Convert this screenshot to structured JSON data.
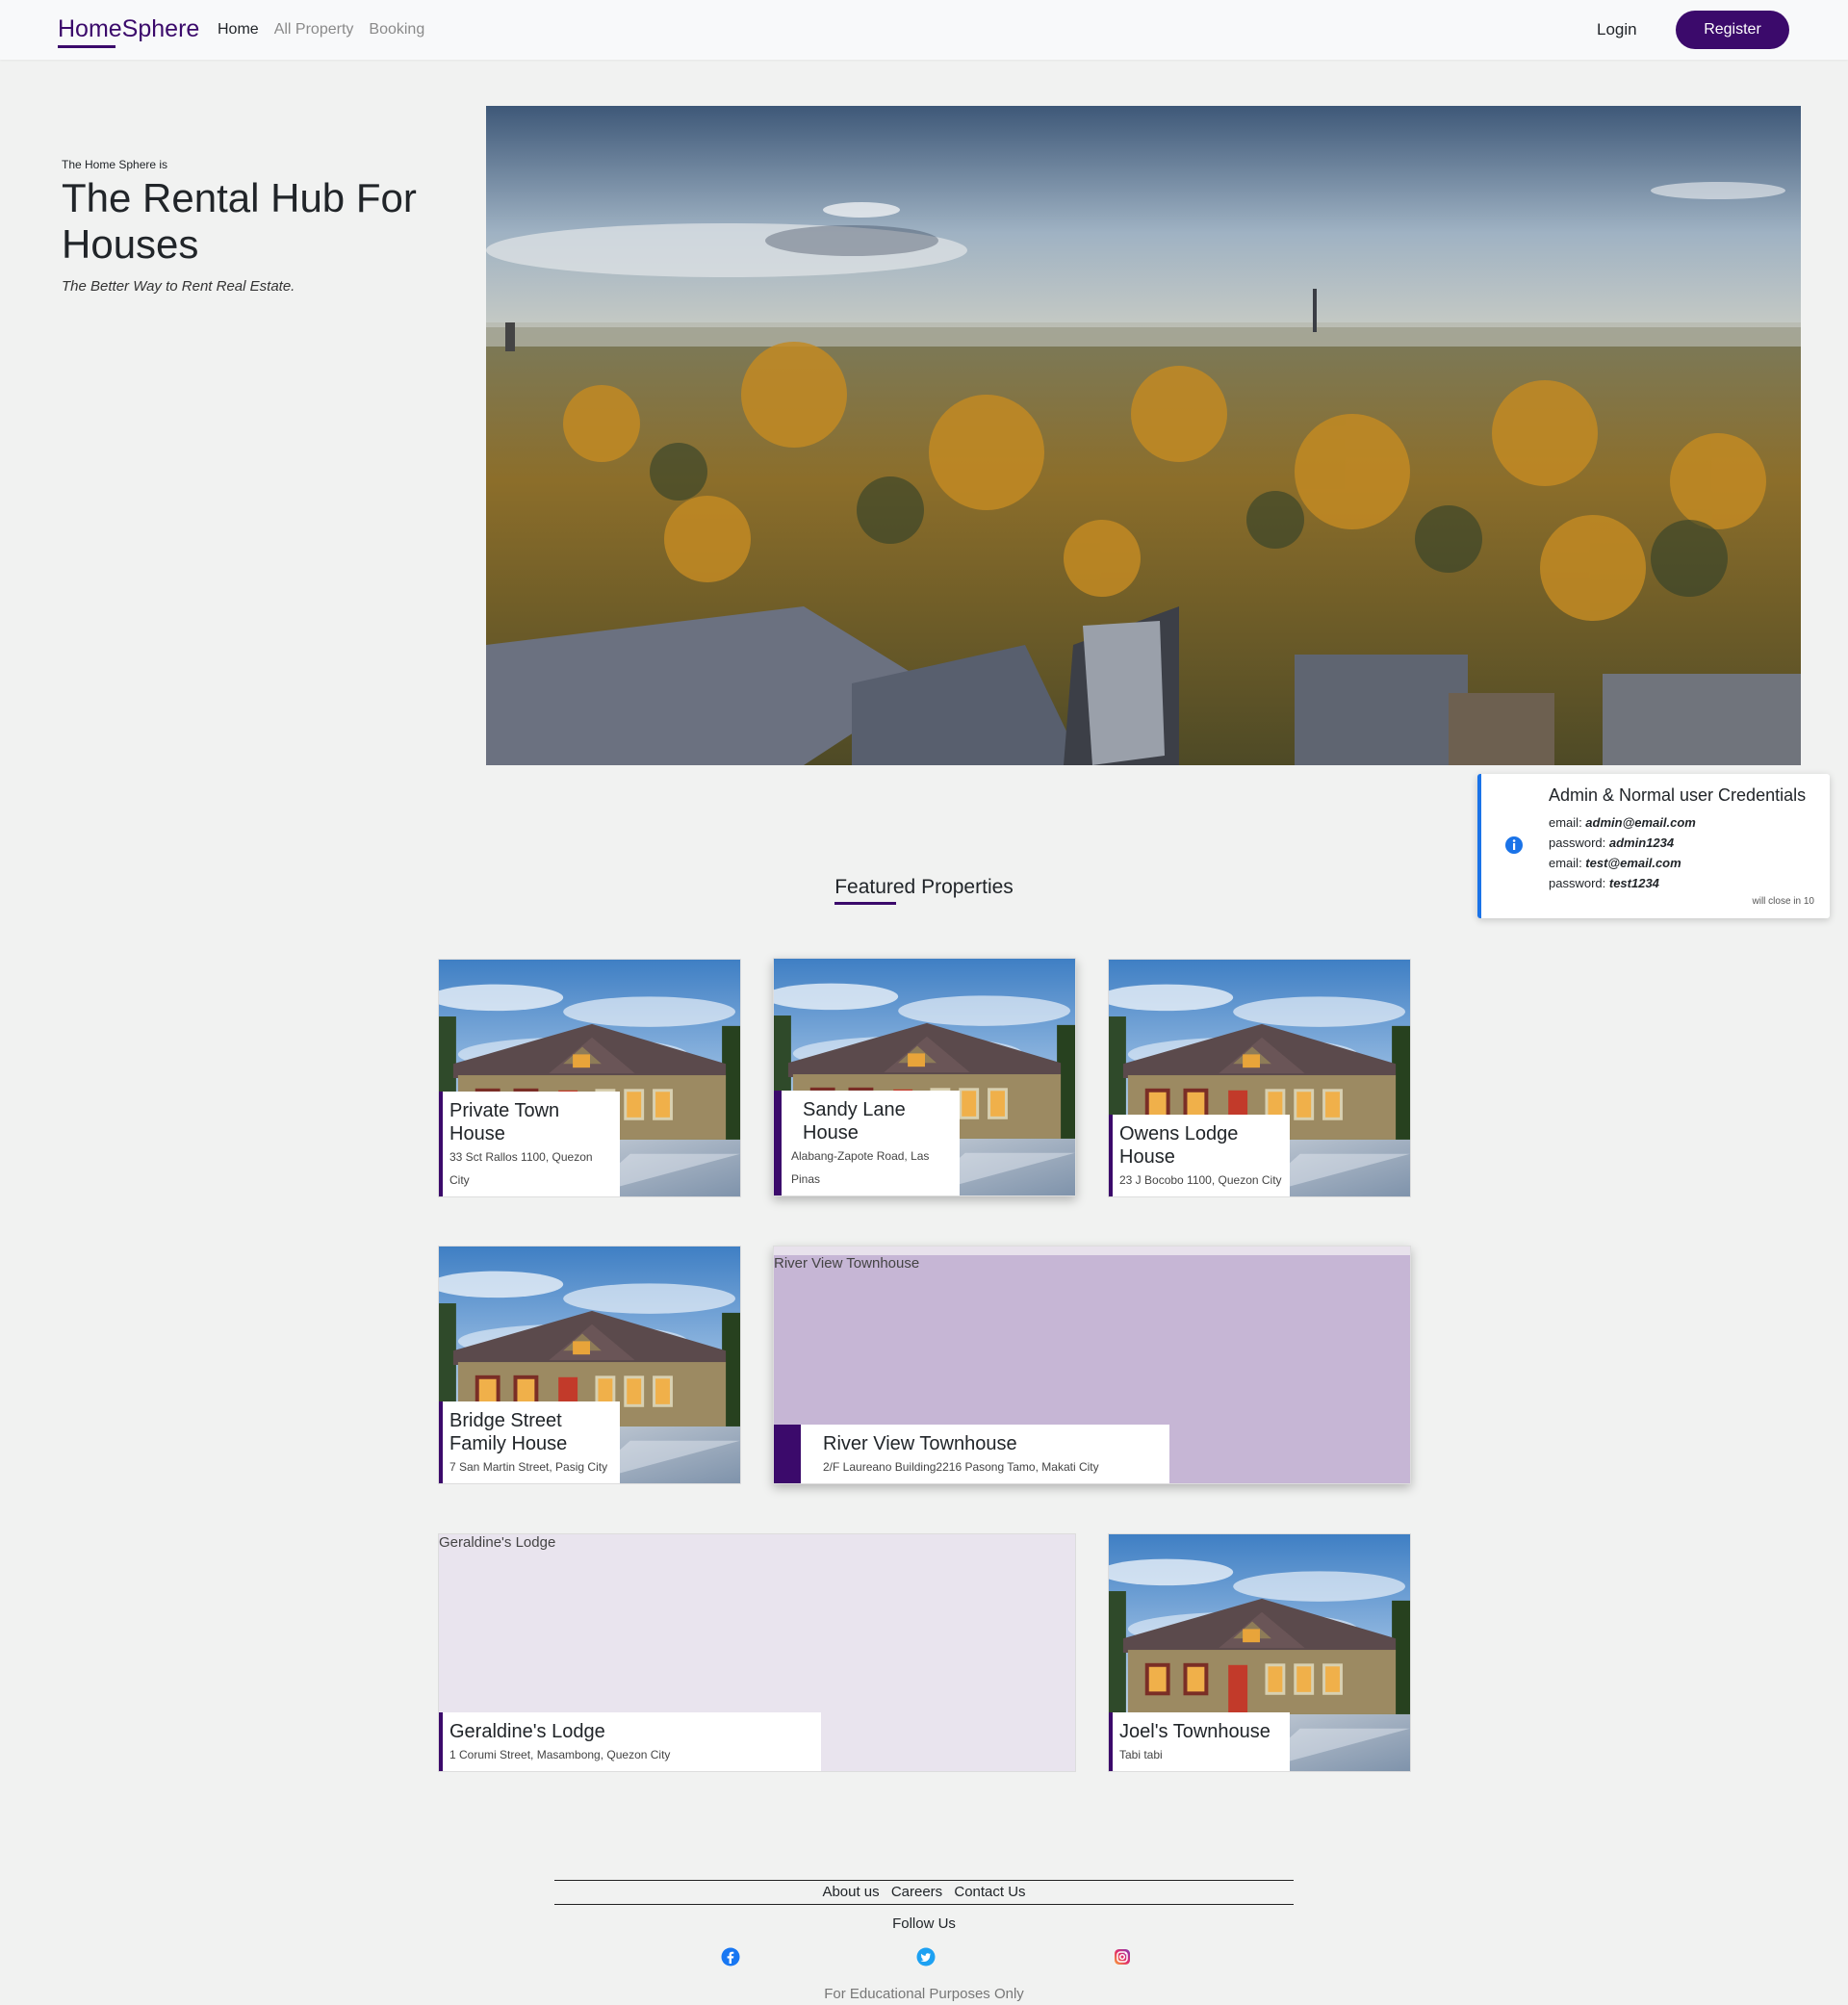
{
  "nav": {
    "brand": "HomeSphere",
    "links": [
      "Home",
      "All Property",
      "Booking"
    ],
    "login": "Login",
    "register": "Register"
  },
  "hero": {
    "pretitle": "The Home Sphere is",
    "title": "The Rental Hub For Houses",
    "tagline": "The Better Way to Rent Real Estate."
  },
  "toast": {
    "title": "Admin & Normal user Credentials",
    "lines": [
      {
        "label": "email: ",
        "value": "admin@email.com"
      },
      {
        "label": "password: ",
        "value": "admin1234"
      },
      {
        "label": "email: ",
        "value": "test@email.com"
      },
      {
        "label": "password: ",
        "value": "test1234"
      }
    ],
    "close_note": "will close in 10"
  },
  "featured": {
    "title": "Featured Properties",
    "properties": [
      {
        "name": "Private Town House",
        "address": "33 Sct Rallos 1100, Quezon City"
      },
      {
        "name": "Sandy Lane House",
        "address": "Alabang-Zapote Road, Las Pinas"
      },
      {
        "name": "Owens Lodge House",
        "address": "23 J Bocobo 1100, Quezon City"
      },
      {
        "name": "Bridge Street Family House",
        "address": "7 San Martin Street, Pasig City"
      },
      {
        "name": "River View Townhouse",
        "address": "2/F Laureano Building2216 Pasong Tamo, Makati City",
        "img_alt": "River View Townhouse"
      },
      {
        "name": "Geraldine's Lodge",
        "address": "1 Corumi Street, Masambong, Quezon City",
        "img_alt": "Geraldine's Lodge"
      },
      {
        "name": "Joel's Townhouse",
        "address": "Tabi tabi"
      }
    ]
  },
  "footer": {
    "links": [
      "About us",
      "Careers",
      "Contact Us"
    ],
    "follow": "Follow Us",
    "socials": [
      "facebook-icon",
      "twitter-icon",
      "instagram-icon"
    ],
    "note": "For Educational Purposes Only"
  },
  "colors": {
    "brand": "#3b0a6b",
    "info": "#1a73e8",
    "background": "#f1f2f1"
  }
}
